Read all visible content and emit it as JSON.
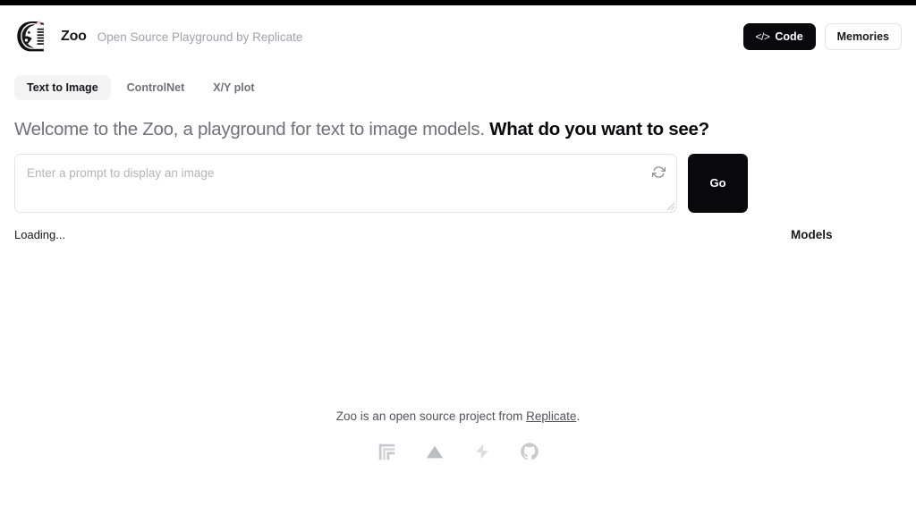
{
  "brand": {
    "logo_icon": "zebra-head-logo",
    "name": "Zoo",
    "tagline": "Open Source Playground by Replicate"
  },
  "header": {
    "code_button": {
      "label": "Code",
      "icon": "code-brackets-icon"
    },
    "memories_button": {
      "label": "Memories"
    }
  },
  "tabs": [
    {
      "label": "Text to Image",
      "active": true
    },
    {
      "label": "ControlNet",
      "active": false
    },
    {
      "label": "X/Y plot",
      "active": false
    }
  ],
  "headline": {
    "lead": "Welcome to the Zoo, a playground for text to image models.",
    "emphasis": "What do you want to see?"
  },
  "prompt": {
    "value": "",
    "placeholder": "Enter a prompt to display an image",
    "shuffle_icon": "refresh-shuffle-icon",
    "resize_handle_icon": "resize-grip-icon",
    "go_label": "Go"
  },
  "status": {
    "text": "Loading..."
  },
  "models_panel": {
    "title": "Models"
  },
  "footer": {
    "text_before": "Zoo is an open source project from ",
    "link_label": "Replicate",
    "text_after": ".",
    "icons": [
      {
        "name": "replicate-logo-icon"
      },
      {
        "name": "vercel-triangle-icon"
      },
      {
        "name": "supabase-bolt-icon"
      },
      {
        "name": "github-logo-icon"
      }
    ]
  },
  "colors": {
    "accent_dark": "#09090b",
    "muted_text": "#71717a",
    "placeholder": "#b4b4bb",
    "border": "#e4e4e7",
    "tab_active_bg": "#f4f4f5",
    "footer_icon": "#d4d4d8"
  }
}
